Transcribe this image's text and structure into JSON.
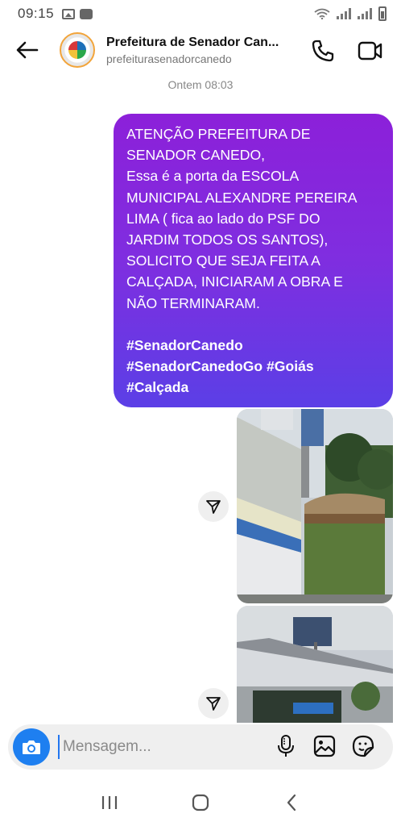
{
  "status_bar": {
    "time": "09:15",
    "left_icons": [
      "image-icon",
      "voicemail-icon"
    ],
    "right_icons": [
      "wifi-icon",
      "signal-icon",
      "signal-icon",
      "battery-icon"
    ]
  },
  "header": {
    "title": "Prefeitura de Senador Can...",
    "username": "prefeiturasenadorcanedo",
    "icons": [
      "back-arrow-icon",
      "avatar",
      "phone-icon",
      "video-camera-icon"
    ]
  },
  "conversation": {
    "timestamp": "Ontem 08:03",
    "message_text": "ATENÇÃO PREFEITURA DE\nSENADOR CANEDO,\nEssa é a porta da ESCOLA\nMUNICIPAL ALEXANDRE PEREIRA\nLIMA ( fica ao lado do PSF DO\nJARDIM TODOS OS SANTOS),\nSOLICITO QUE SEJA FEITA A\nCALÇADA, INICIARAM A OBRA E\nNÃO TERMINARAM.",
    "hashtags": "#SenadorCanedo\n#SenadorCanedoGo #Goiás\n#Calçada",
    "bubble_colors": [
      "#8c20d9",
      "#5b3fe6"
    ],
    "photos": [
      "photo-school-wall-dumpster",
      "photo-school-building-street"
    ]
  },
  "composer": {
    "placeholder": "Mensagem...",
    "icons": [
      "camera-icon",
      "microphone-icon",
      "gallery-icon",
      "sticker-icon"
    ],
    "camera_color": "#1e7ff0"
  },
  "navbar": {
    "icons": [
      "recents-icon",
      "home-icon",
      "back-icon"
    ]
  }
}
